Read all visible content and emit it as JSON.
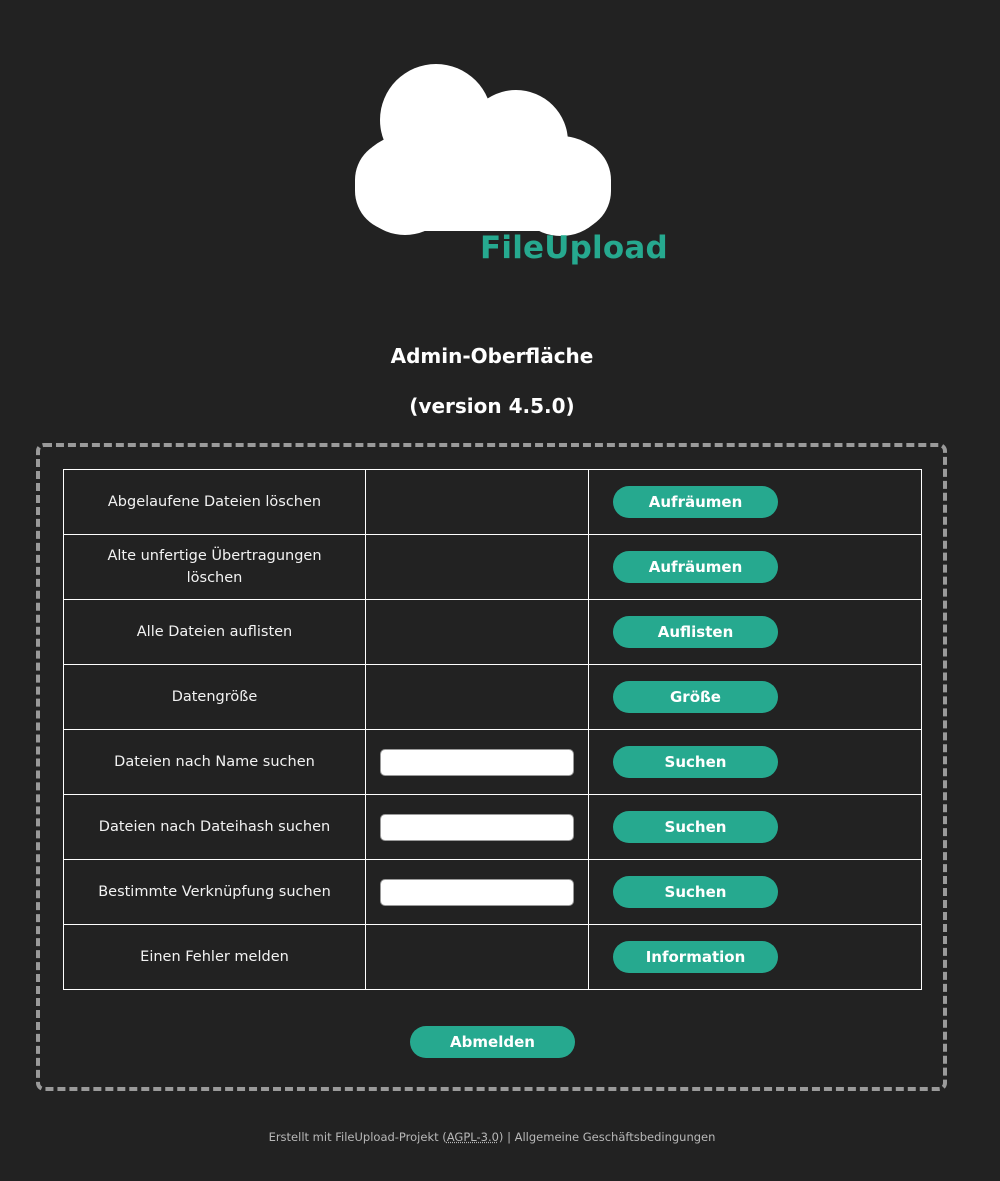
{
  "brand": {
    "name": "FileUpload",
    "logo_icon": "cloud-icon",
    "accent_color": "#26a98f"
  },
  "page": {
    "title": "Admin-Oberfläche",
    "version": "(version 4.5.0)"
  },
  "rows": [
    {
      "label": "Abgelaufene Dateien löschen",
      "has_input": false,
      "button": "Aufräumen"
    },
    {
      "label": "Alte unfertige Übertragungen löschen",
      "has_input": false,
      "button": "Aufräumen"
    },
    {
      "label": "Alle Dateien auflisten",
      "has_input": false,
      "button": "Auflisten"
    },
    {
      "label": "Datengröße",
      "has_input": false,
      "button": "Größe"
    },
    {
      "label": "Dateien nach Name suchen",
      "has_input": true,
      "input_value": "",
      "button": "Suchen"
    },
    {
      "label": "Dateien nach Dateihash suchen",
      "has_input": true,
      "input_value": "",
      "button": "Suchen"
    },
    {
      "label": "Bestimmte Verknüpfung suchen",
      "has_input": true,
      "input_value": "",
      "button": "Suchen"
    },
    {
      "label": "Einen Fehler melden",
      "has_input": false,
      "button": "Information"
    }
  ],
  "logout_label": "Abmelden",
  "footer": {
    "prefix": "Erstellt mit FileUpload-Projekt (",
    "license": "AGPL-3.0",
    "middle": ") | ",
    "terms": "Allgemeine Geschäftsbedingungen"
  },
  "colors": {
    "background": "#222222",
    "button": "#26a98f",
    "panel_border": "#9a9a9a"
  }
}
